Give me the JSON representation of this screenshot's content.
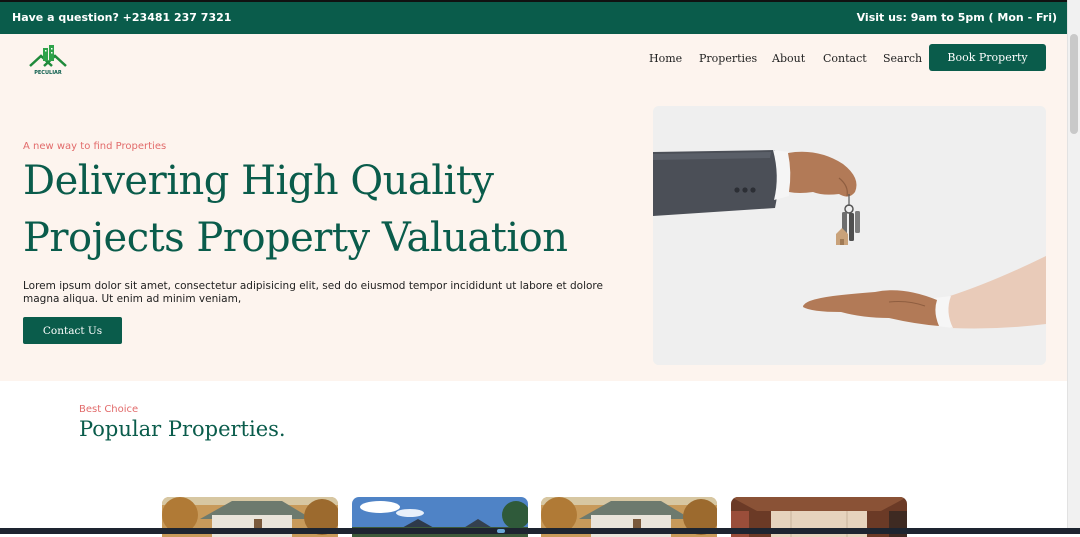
{
  "topbar": {
    "phone_text": "Have a question? +23481 237 7321",
    "hours_text": "Visit us: 9am to 5pm ( Mon - Fri)"
  },
  "brand": {
    "logo_text": "PECULIAR",
    "logo_icon": "house-buildings-icon"
  },
  "nav": {
    "items": [
      {
        "label": "Home"
      },
      {
        "label": "Properties"
      },
      {
        "label": "About"
      },
      {
        "label": "Contact"
      },
      {
        "label": "Search"
      }
    ],
    "cta_label": "Book Property"
  },
  "hero": {
    "eyebrow": "A new way to find Properties",
    "headline": "Delivering High Quality Projects Property Valuation",
    "lead": "Lorem ipsum dolor sit amet, consectetur adipisicing elit, sed do eiusmod tempor incididunt ut labore et dolore magna aliqua. Ut enim ad minim veniam,",
    "cta_label": "Contact Us",
    "image_subject": "hand-handing-over-house-keys"
  },
  "popular": {
    "eyebrow": "Best Choice",
    "title": "Popular Properties."
  },
  "colors": {
    "brand_green": "#0a5c4b",
    "accent_coral": "#e26b6b",
    "hero_background": "#fdf4ee"
  }
}
